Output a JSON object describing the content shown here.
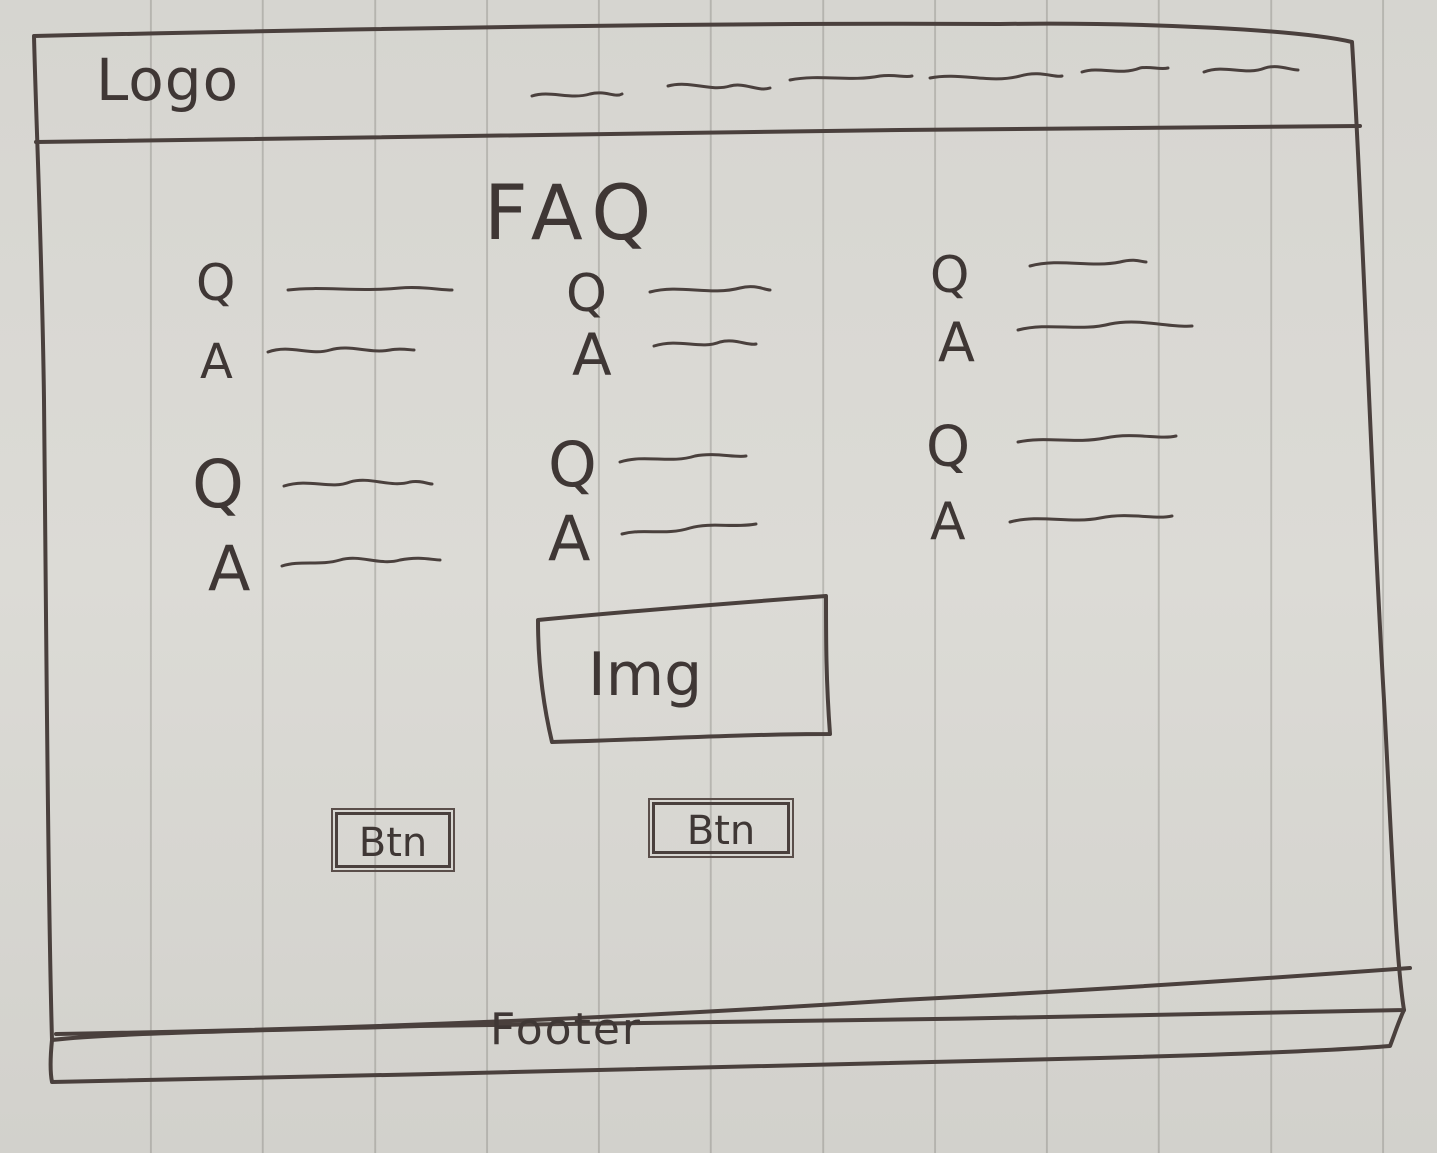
{
  "header": {
    "logo_text": "Logo",
    "nav_placeholder_count": 6
  },
  "main": {
    "title": "FAQ",
    "faq_items": [
      {
        "q": "Q",
        "a": "A"
      },
      {
        "q": "Q",
        "a": "A"
      },
      {
        "q": "Q",
        "a": "A"
      },
      {
        "q": "Q",
        "a": "A"
      },
      {
        "q": "Q",
        "a": "A"
      },
      {
        "q": "Q",
        "a": "A"
      }
    ],
    "image_label": "Img",
    "buttons": [
      {
        "label": "Btn"
      },
      {
        "label": "Btn"
      }
    ]
  },
  "footer": {
    "label": "Footer"
  },
  "colors": {
    "paper": "#d9d8d3",
    "ink": "#3f3735",
    "rule": "#78766f"
  }
}
